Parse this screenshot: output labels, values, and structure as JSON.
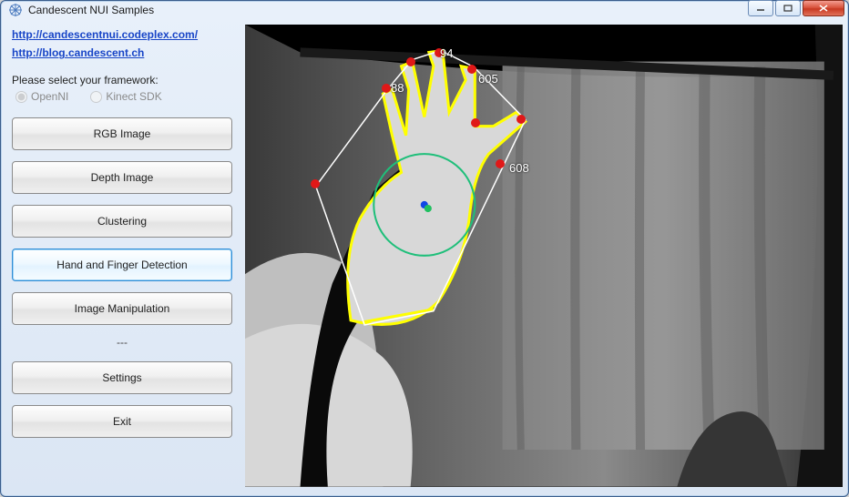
{
  "window": {
    "title": "Candescent NUI Samples"
  },
  "links": {
    "codeplex": "http://candescentnui.codeplex.com/",
    "blog": "http://blog.candescent.ch"
  },
  "framework": {
    "label": "Please select your framework:",
    "option_openni": "OpenNI",
    "option_kinect": "Kinect SDK",
    "selected": "OpenNI",
    "enabled": false
  },
  "buttons": {
    "rgb": "RGB Image",
    "depth": "Depth Image",
    "clustering": "Clustering",
    "hand_finger": "Hand and Finger Detection",
    "image_manipulation": "Image Manipulation",
    "placeholder": "---",
    "settings": "Settings",
    "exit": "Exit",
    "selected": "hand_finger"
  },
  "detection": {
    "finger_depth_labels": [
      "88",
      "94",
      "605",
      "608"
    ],
    "palm_circle_color": "#1fbf7a",
    "hand_outline_color": "#ffff00",
    "hull_color": "#ffffff",
    "finger_dot_color": "#e01818"
  }
}
